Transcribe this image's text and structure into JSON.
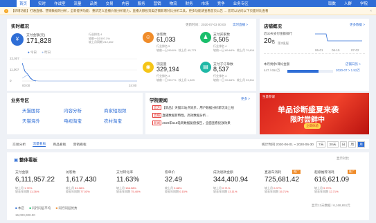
{
  "nav": {
    "items": [
      "首页",
      "实时",
      "作战室",
      "流量",
      "品类",
      "交易",
      "内容",
      "服务",
      "营销",
      "物流",
      "财务",
      "市场",
      "竞争",
      "业务专区",
      "取数",
      "人群",
      "学院"
    ],
    "active_index": 0
  },
  "notice": {
    "icon": "warning-icon",
    "text": "【新增功能】打通直播、营销数据的分析，全新提供功能：重新定义直播价值分析能力，直播大额投资类店铺新增对比分析工具，更多功能请查看首页公告 … 您可以访问以下页面对比查看",
    "close": "×"
  },
  "realtime": {
    "title": "实时概况",
    "updated": "更新时间：2020-07-03 00:00",
    "link": "实时直播 >",
    "payment": {
      "label": "支付金额(元)",
      "value": "171,828",
      "sub1_label": "行业排名",
      "sub1_value": "4",
      "sub2_label": "较前一日",
      "sub2_value": "597.1%",
      "sub3_label": "较上月同期",
      "sub3_value": "212,452"
    },
    "legend": [
      "今日",
      "昨日"
    ],
    "y_ticks": [
      "22,007",
      "11,007",
      "0"
    ],
    "x_ticks": [
      "00:00",
      "24:00"
    ],
    "metrics": [
      {
        "label": "访客数",
        "value": "61,033",
        "sub": "行业排名 5\n较前一日 99.6%   较上月 45,773"
      },
      {
        "label": "支付买家数",
        "value": "5,505",
        "sub": "行业排名 4\n较前一日 89.64%   较上月 79,614"
      },
      {
        "label": "浏览量",
        "value": "329,194",
        "sub": "行业排名 3\n较前一日 99.7%   较上月 1,823"
      },
      {
        "label": "支付子订单数",
        "value": "8,537",
        "sub": "行业排名 4\n较前一日 99.84%   较上月 93,511"
      }
    ]
  },
  "rank": {
    "title": "店铺概况",
    "link": "更多数据 >",
    "l1": "近30天支付金额排行",
    "rank_value": "20",
    "rank_unit": "名",
    "rank_sub": "第2级层",
    "chart_ticks": [
      "06-01",
      "06-15",
      "07-02"
    ],
    "l2": "本月剩余/目标金额",
    "l2_link": "店铺日历 >",
    "l2_sub": "447 / 654万",
    "progress": 0.68,
    "l2_link2": "2020-07 > 1.52万"
  },
  "business": {
    "title": "业务专区",
    "links": [
      "天猫国际",
      "内容分析",
      "商家短视频",
      "天猫海外",
      "电视淘宝",
      "农村淘宝"
    ]
  },
  "academy": {
    "title": "学院要闻",
    "link": "更多 >",
    "items": [
      {
        "tag": "官方",
        "text": "【新品】天猫三站点同步，用户数据分析新玩法上线"
      },
      {
        "tag": "直播",
        "text": "直播数据新特性，高效数据分析…"
      },
      {
        "tag": "新闻",
        "text": "2020年618电商数据复盘报告，全面查看投放效果"
      }
    ]
  },
  "banner": {
    "brand": "生意参谋",
    "line1": "单品诊断盛夏来袭",
    "line2": "限时尝鲜中",
    "cta": "立即体验"
  },
  "tabs": {
    "items": [
      "交易分析",
      "流量看板",
      "商品看板",
      "营销看板"
    ],
    "active_index": 1,
    "date_range": "统计时间 2020-06-01 ~ 2020-06-30",
    "periods": [
      "7天",
      "30天",
      "日",
      "周",
      "月"
    ]
  },
  "core": {
    "title": "整体看板",
    "opt": "显示对比",
    "kpis": [
      {
        "label": "支付金额",
        "value": "6,111,957.22",
        "c1": "较上月  1.72%",
        "c2": "较去年同期  11.26%"
      },
      {
        "label": "访客数",
        "value": "1,617,430",
        "c1": "较上月  81.98%",
        "c2": "较去年同期  77.03%"
      },
      {
        "label": "支付转化率",
        "value": "11.63%",
        "c1": "较上月  156.38%",
        "c2": "较去年同期  75.40%"
      },
      {
        "label": "客单价",
        "value": "32.49",
        "c1": "较上月  2.86%",
        "c2": "较去年同期  0.15%"
      },
      {
        "label": "成功退款金额",
        "value": "344,400.94",
        "c1": "较上月  0.71%",
        "c2": "较去年同期  13.11%"
      },
      {
        "label": "直通车消耗",
        "value": "725,681.42",
        "c1": "较上月  0.07%",
        "c2": "较去年同期  15.71%"
      },
      {
        "label": "超级推荐消耗",
        "value": "616,621.09",
        "c1": "较上月  5.72%",
        "c2": "较去年同期  12.71%"
      }
    ],
    "legend": [
      "本店",
      "同行同层平均",
      "同行同层优秀"
    ],
    "y_tick": "15,000,000.00",
    "footer": "显示12天数据 / 6,168,651元"
  },
  "colors": {
    "primary": "#2f6ed6",
    "orange": "#f08c2a",
    "red": "#e64340",
    "green": "#19be6b",
    "yellow": "#f5c518",
    "teal": "#1fb8a6"
  }
}
